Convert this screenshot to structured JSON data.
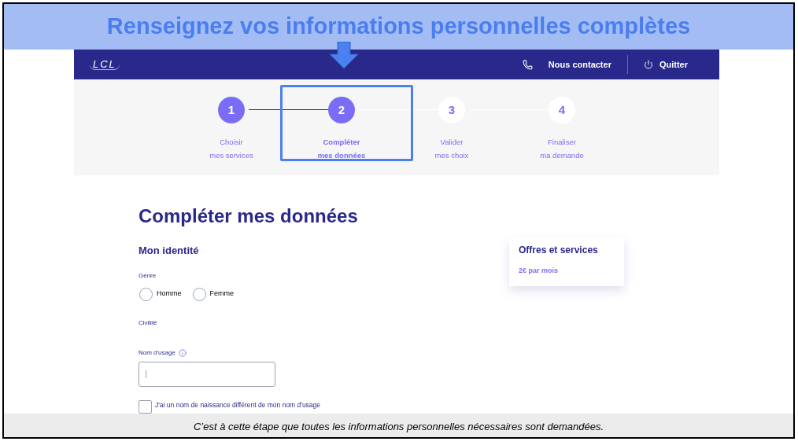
{
  "banner": {
    "title": "Renseignez vos informations personnelles complètes"
  },
  "navbar": {
    "logo": "LCL",
    "contact": "Nous contacter",
    "quit": "Quitter"
  },
  "steps": [
    {
      "number": "1",
      "line1": "Choisir",
      "line2": "mes services",
      "kind": "done",
      "selected": false
    },
    {
      "number": "2",
      "line1": "Compléter",
      "line2": "mes données",
      "kind": "current",
      "selected": true
    },
    {
      "number": "3",
      "line1": "Valider",
      "line2": "mes choix",
      "kind": "todo",
      "selected": false
    },
    {
      "number": "4",
      "line1": "Finaliser",
      "line2": "ma demande",
      "kind": "todo",
      "selected": false
    }
  ],
  "form": {
    "title": "Compléter mes données",
    "section": "Mon identité",
    "genre_label": "Genre",
    "genre_options": [
      {
        "label": "Homme",
        "selected": false
      },
      {
        "label": "Femme",
        "selected": false
      }
    ],
    "civilite_label": "Civilité",
    "nom_label": "Nom d'usage",
    "checkbox": {
      "label": "J'ai un nom de naissance différent de mon nom d'usage",
      "checked": false
    }
  },
  "offer_card": {
    "title": "Offres et services",
    "price": "2€ par mois"
  },
  "caption": "C’est à cette étape que toutes les informations personnelles nécessaires sont demandées."
}
